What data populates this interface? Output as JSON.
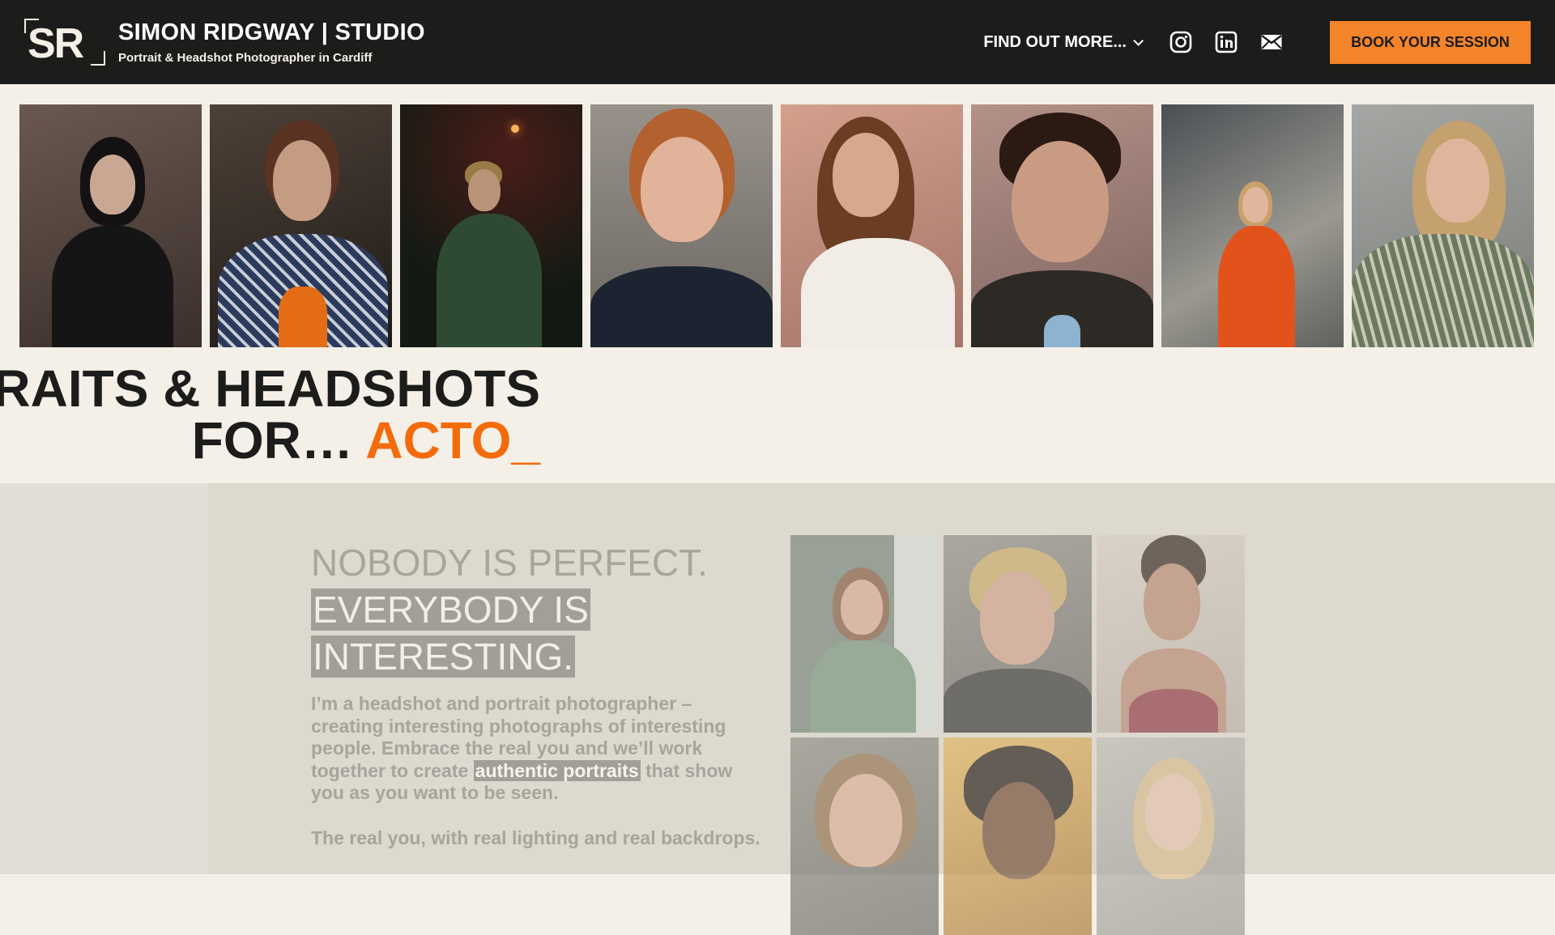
{
  "header": {
    "logo_text": "SR",
    "title": "SIMON RIDGWAY | STUDIO",
    "subtitle": "Portrait & Headshot Photographer in Cardiff",
    "nav_more": "FIND OUT MORE...",
    "book_button": "BOOK YOUR SESSION",
    "social_icons": [
      "instagram-icon",
      "linkedin-icon",
      "mail-icon"
    ]
  },
  "hero": {
    "line1": "RAITS & HEADSHOTS",
    "line2_prefix": "FOR… ",
    "line2_accent": "ACTO_"
  },
  "strip": [
    {
      "name": "portrait-woman-black-dress"
    },
    {
      "name": "portrait-woman-patterned-coat"
    },
    {
      "name": "portrait-man-green-sweater"
    },
    {
      "name": "portrait-redhead-girl"
    },
    {
      "name": "portrait-woman-laughing"
    },
    {
      "name": "portrait-man-curly-hair"
    },
    {
      "name": "portrait-woman-orange-suit"
    },
    {
      "name": "portrait-woman-striped-shirt"
    }
  ],
  "about": {
    "tag_line1": "NOBODY IS PERFECT.",
    "tag_line2": "EVERYBODY IS",
    "tag_line3": "INTERESTING.",
    "intro_a": "I’m a headshot and portrait photographer – creating interesting photographs of interesting people. Embrace the real you and we’ll work together to create ",
    "intro_link": "authentic portraits",
    "intro_b": " that show you as you want to be seen.",
    "intro2": "The real you, with real lighting and real backdrops."
  },
  "colors": {
    "header_bg": "#1c1c1a",
    "accent": "#f46b0c",
    "button": "#f4842a",
    "page_bg": "#f4f0e7"
  }
}
